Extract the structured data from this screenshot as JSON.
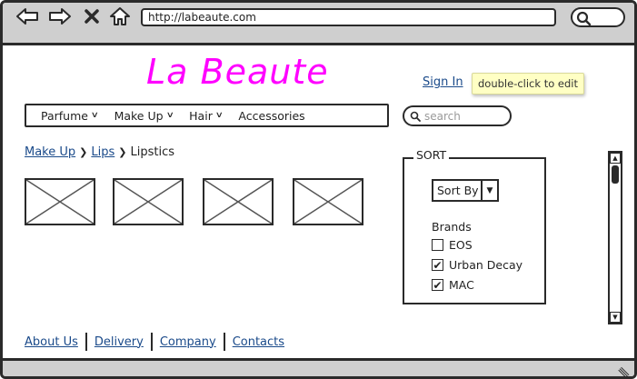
{
  "browser": {
    "url": "http://labeaute.com"
  },
  "site": {
    "logo": "La Beaute",
    "sign_in": "Sign In",
    "tooltip": "double-click to edit"
  },
  "menu": {
    "items": [
      {
        "label": "Parfume",
        "has_dropdown": true
      },
      {
        "label": "Make Up",
        "has_dropdown": true
      },
      {
        "label": "Hair",
        "has_dropdown": true
      },
      {
        "label": "Accessories",
        "has_dropdown": false
      }
    ]
  },
  "search": {
    "placeholder": "search"
  },
  "breadcrumb": {
    "items": [
      "Make Up",
      "Lips",
      "Lipstics"
    ]
  },
  "sort": {
    "legend": "SORT",
    "select_label": "Sort By",
    "brands_title": "Brands",
    "brands": [
      {
        "label": "EOS",
        "checked": false
      },
      {
        "label": "Urban Decay",
        "checked": true
      },
      {
        "label": "MAC",
        "checked": true
      }
    ]
  },
  "footer": {
    "links": [
      "About Us",
      "Delivery",
      "Company",
      "Contacts"
    ]
  },
  "colors": {
    "logo": "#ff00ff",
    "link": "#1a4a8a",
    "chrome": "#cfcfcf",
    "tooltip_bg": "#ffffc4"
  }
}
